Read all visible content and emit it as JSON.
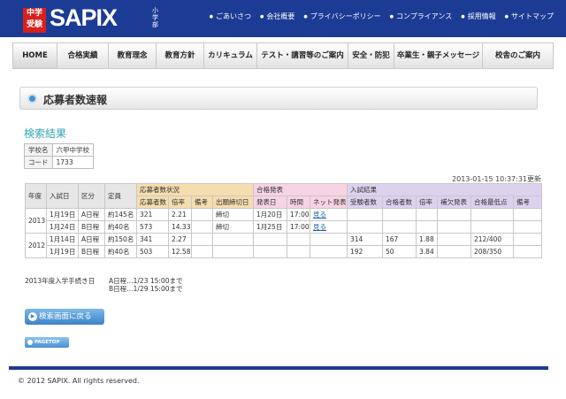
{
  "header": {
    "logo_mark": "中学受験",
    "logo_text": "SAPIX",
    "logo_sub": "小学部",
    "links": [
      "ごあいさつ",
      "会社概要",
      "プライバシーポリシー",
      "コンプライアンス",
      "採用情報",
      "サイトマップ"
    ]
  },
  "nav": [
    "HOME",
    "合格実績",
    "教育理念",
    "教育方針",
    "カリキュラム",
    "テスト・講習等のご案内",
    "安全・防犯",
    "卒業生・親子メッセージ",
    "校舎のご案内"
  ],
  "page_title": "応募者数速報",
  "result_title": "検索結果",
  "school": {
    "name_label": "学校名",
    "name": "六甲中学校",
    "code_label": "コード",
    "code": "1733"
  },
  "timestamp": "2013-01-15 10:37:31更新",
  "table": {
    "groups": {
      "apply": "応募者数状況",
      "pass": "合格発表",
      "exam": "入試結果"
    },
    "base_headers": [
      "年度",
      "入試日",
      "区分",
      "定員"
    ],
    "sub_headers": [
      "応募者数",
      "倍率",
      "備考",
      "出願締切日",
      "発表日",
      "時間",
      "ネット発表",
      "受験者数",
      "合格者数",
      "倍率",
      "補欠発表",
      "合格最低点",
      "備考"
    ],
    "rows": [
      [
        "2013",
        "1月19日",
        "A日程",
        "約145名",
        "321",
        "2.21",
        "",
        "締切",
        "1月20日",
        "17:00",
        "見る",
        "",
        "",
        "",
        "",
        "",
        ""
      ],
      [
        "",
        "1月24日",
        "B日程",
        "約40名",
        "573",
        "14.33",
        "",
        "締切",
        "1月25日",
        "17:00",
        "見る",
        "",
        "",
        "",
        "",
        "",
        ""
      ],
      [
        "2012",
        "1月14日",
        "A日程",
        "約150名",
        "341",
        "2.27",
        "",
        "",
        "",
        "",
        "",
        "314",
        "167",
        "1.88",
        "",
        "212/400",
        ""
      ],
      [
        "",
        "1月19日",
        "B日程",
        "約40名",
        "503",
        "12.58",
        "",
        "",
        "",
        "",
        "",
        "192",
        "50",
        "3.84",
        "",
        "208/350",
        ""
      ]
    ]
  },
  "note": {
    "label": "2013年度入学手続き日",
    "a": "A日程…1/23 15:00まで",
    "b": "B日程…1/29 15:00まで"
  },
  "back_button": "検索画面に戻る",
  "pagetop": "PAGETOP",
  "copyright": "© 2012 SAPIX. All rights reserved.",
  "colors": {
    "brand_blue": "#1c3b94",
    "logo_red": "#d8201c",
    "accent_teal": "#34a7b4",
    "apply_header": "#f5ddae",
    "pass_header": "#f7d3e4",
    "exam_header": "#dcd2ef"
  }
}
